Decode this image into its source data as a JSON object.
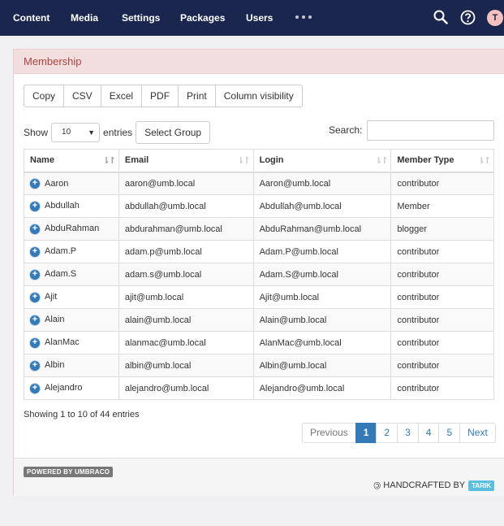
{
  "nav": {
    "items": [
      "Content",
      "Media",
      "Settings",
      "Packages",
      "Users"
    ],
    "more_icon": "ellipsis-icon",
    "search_icon": "search-icon",
    "help_icon": "help-circle-icon",
    "avatar_initial": "T",
    "bg_color": "#1b264f"
  },
  "panel": {
    "title": "Membership",
    "export_buttons": [
      "Copy",
      "CSV",
      "Excel",
      "PDF",
      "Print",
      "Column visibility"
    ],
    "show_label": "Show",
    "page_length": "10",
    "entries_label": "entries",
    "select_group_label": "Select Group",
    "search_label": "Search:",
    "search_value": ""
  },
  "table": {
    "columns": [
      "Name",
      "Email",
      "Login",
      "Member Type"
    ],
    "rows": [
      [
        "Aaron",
        "aaron@umb.local",
        "Aaron@umb.local",
        "contributor"
      ],
      [
        "Abdullah",
        "abdullah@umb.local",
        "Abdullah@umb.local",
        "Member"
      ],
      [
        "AbduRahman",
        "abdurahman@umb.local",
        "AbduRahman@umb.local",
        "blogger"
      ],
      [
        "Adam.P",
        "adam.p@umb.local",
        "Adam.P@umb.local",
        "contributor"
      ],
      [
        "Adam.S",
        "adam.s@umb.local",
        "Adam.S@umb.local",
        "contributor"
      ],
      [
        "Ajit",
        "ajit@umb.local",
        "Ajit@umb.local",
        "contributor"
      ],
      [
        "Alain",
        "alain@umb.local",
        "Alain@umb.local",
        "contributor"
      ],
      [
        "AlanMac",
        "alanmac@umb.local",
        "AlanMac@umb.local",
        "contributor"
      ],
      [
        "Albin",
        "albin@umb.local",
        "Albin@umb.local",
        "contributor"
      ],
      [
        "Alejandro",
        "alejandro@umb.local",
        "Alejandro@umb.local",
        "contributor"
      ]
    ],
    "info": "Showing 1 to 10 of 44 entries"
  },
  "pagination": {
    "previous": "Previous",
    "pages": [
      "1",
      "2",
      "3",
      "4",
      "5"
    ],
    "current": "1",
    "next": "Next"
  },
  "footer": {
    "powered": "POWERED BY UMBRACO",
    "handcrafted": "HANDCRAFTED BY",
    "author": "TARIK"
  }
}
